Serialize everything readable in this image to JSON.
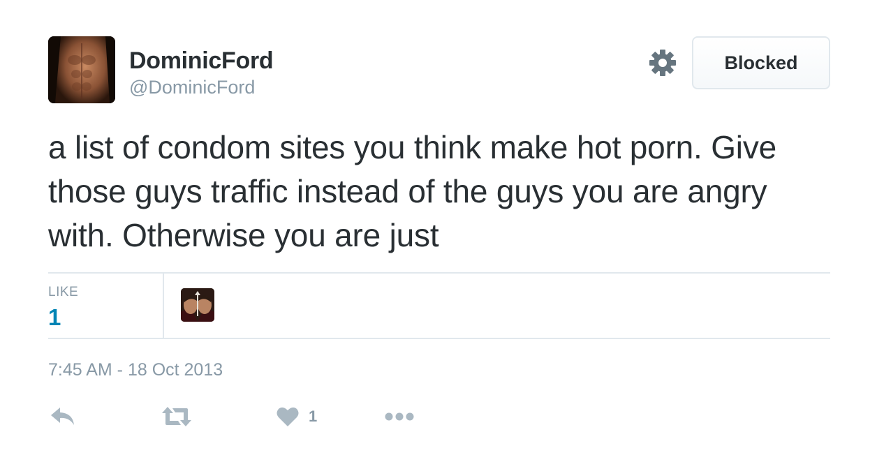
{
  "header": {
    "fullname": "DominicFord",
    "username": "@DominicFord",
    "blocked_label": "Blocked"
  },
  "tweet": {
    "text": "a list of condom sites you think make hot porn. Give those guys traffic instead of the guys you are angry with. Otherwise you are just",
    "timestamp": "7:45 AM - 18 Oct 2013"
  },
  "stats": {
    "like_label": "LIKE",
    "like_count": "1"
  },
  "actions": {
    "like_count": "1"
  },
  "icons": {
    "settings": "gear-icon",
    "reply": "reply-icon",
    "retweet": "retweet-icon",
    "like": "heart-icon",
    "more": "more-dots-icon"
  },
  "colors": {
    "text": "#292f33",
    "muted": "#8899a6",
    "link": "#0084b4",
    "divider": "#e1e8ed",
    "icon": "#aab8c2"
  }
}
